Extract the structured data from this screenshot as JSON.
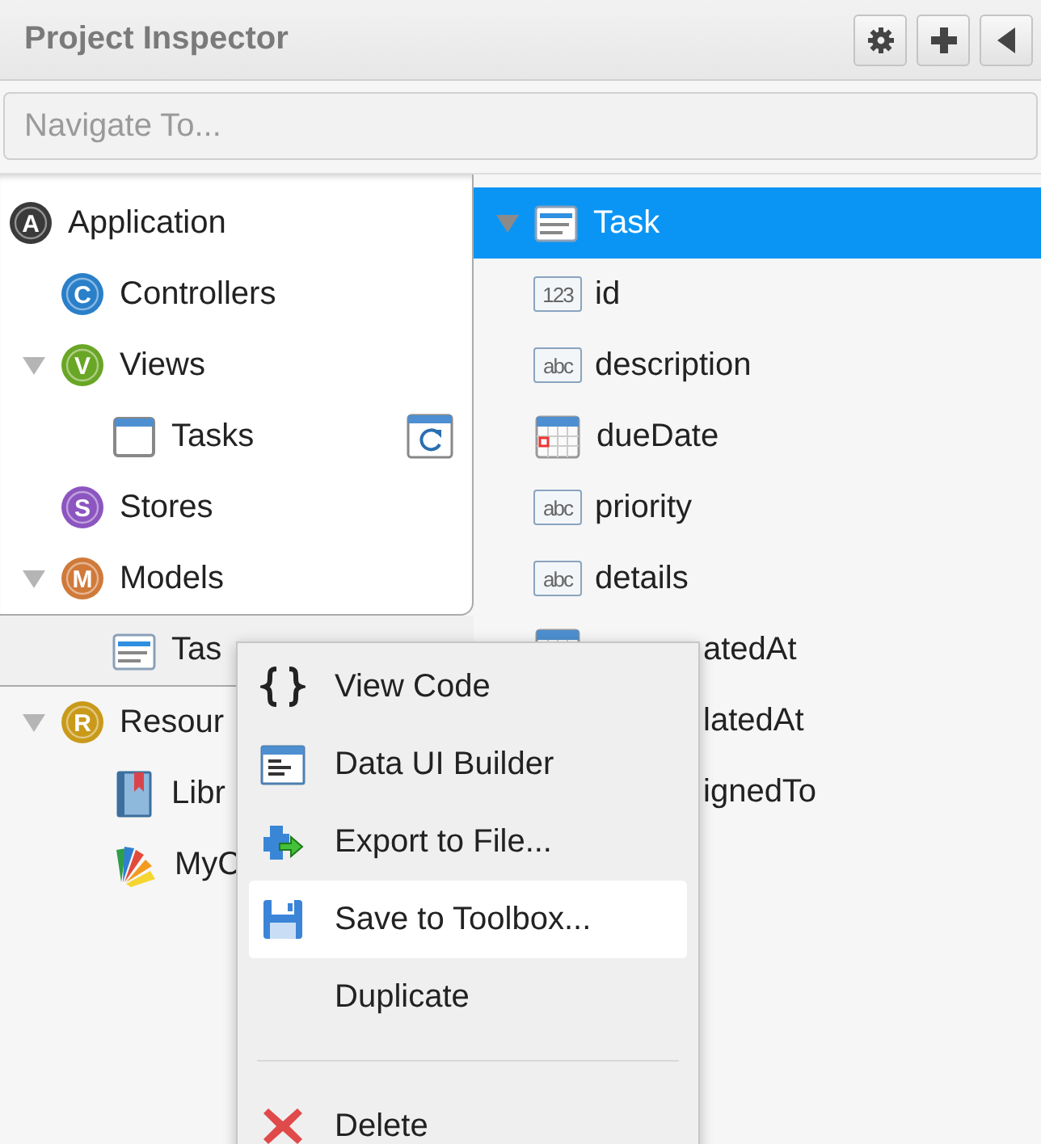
{
  "panel": {
    "title": "Project Inspector"
  },
  "toolbar": [
    {
      "kind": "gear"
    },
    {
      "kind": "plus"
    },
    {
      "kind": "back"
    }
  ],
  "search": {
    "placeholder": "Navigate To..."
  },
  "project_tree": [
    {
      "label": "Application",
      "kind": "badge",
      "badge": "A",
      "color": "#3a3a3a",
      "children": [
        {
          "label": "Controllers",
          "kind": "badge",
          "badge": "C",
          "color": "#2a7fc9"
        },
        {
          "label": "Views",
          "kind": "badge",
          "badge": "V",
          "color": "#6aa625",
          "expanded": true,
          "children": [
            {
              "label": "Tasks",
              "kind": "view",
              "reload": true
            }
          ]
        },
        {
          "label": "Stores",
          "kind": "badge",
          "badge": "S",
          "color": "#8c55c0"
        },
        {
          "label": "Models",
          "kind": "badge",
          "badge": "M",
          "color": "#d07a3a",
          "expanded": true,
          "children": [
            {
              "label": "Tas",
              "kind": "model",
              "highlighted": true
            }
          ]
        },
        {
          "label": "Resour",
          "kind": "badge",
          "badge": "R",
          "color": "#c99a1a",
          "expanded": true,
          "children": [
            {
              "label": "Libr",
              "kind": "library"
            },
            {
              "label": "MyC",
              "kind": "theme"
            }
          ]
        }
      ]
    }
  ],
  "model_tree": [
    {
      "label": "Task",
      "kind": "model",
      "selected": true,
      "expanded": true,
      "children": [
        {
          "label": "id",
          "kind": "number",
          "icon_text": "123",
          "selected": false
        },
        {
          "label": "description",
          "kind": "string",
          "icon_text": "abc",
          "selected": false
        },
        {
          "label": "dueDate",
          "kind": "date",
          "selected": false
        },
        {
          "label": "priority",
          "kind": "string",
          "icon_text": "abc",
          "selected": false
        },
        {
          "label": "details",
          "kind": "string",
          "icon_text": "abc",
          "selected": false
        },
        {
          "label": "atedAt",
          "kind": "date",
          "covered": true,
          "selected": false
        },
        {
          "label": "latedAt",
          "kind": "covered",
          "covered": true,
          "selected": false
        },
        {
          "label": "ignedTo",
          "kind": "covered",
          "covered": true,
          "selected": false
        }
      ]
    }
  ],
  "context_menu": [
    {
      "kind": "braces",
      "label": "View Code",
      "selected": false
    },
    {
      "kind": "form",
      "label": "Data UI Builder",
      "selected": false
    },
    {
      "kind": "export",
      "label": "Export to File...",
      "selected": false
    },
    {
      "kind": "save",
      "label": "Save to Toolbox...",
      "selected": true
    },
    {
      "kind": "plain",
      "label": "Duplicate",
      "selected": false
    },
    {
      "kind": "separator"
    },
    {
      "kind": "delete",
      "label": "Delete",
      "selected": false
    }
  ]
}
